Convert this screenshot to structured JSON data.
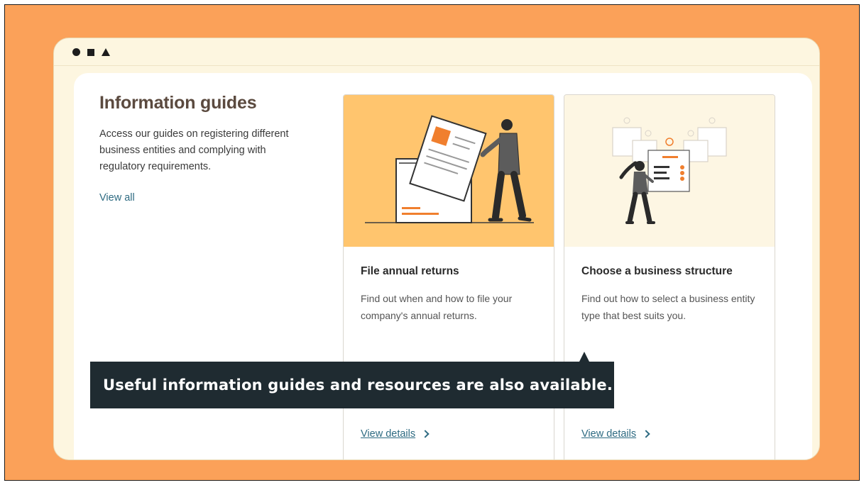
{
  "window": {
    "controls": [
      "circle",
      "square",
      "triangle"
    ]
  },
  "intro": {
    "title": "Information guides",
    "description": "Access our guides on registering different business entities and complying with regulatory requirements.",
    "view_all": "View all"
  },
  "cards": [
    {
      "title": "File annual returns",
      "description": "Find out when and how to file your company's annual returns.",
      "link": "View details",
      "illustration": "person-filing-documents-illustration"
    },
    {
      "title": "Choose a business structure",
      "description": "Find out how to select a business entity type that best suits you.",
      "link": "View details",
      "illustration": "person-choosing-structure-illustration"
    }
  ],
  "tooltip": {
    "text": "Useful information guides and resources are also available."
  },
  "colors": {
    "backdrop": "#fba159",
    "card_1_image_bg": "#ffc56e",
    "card_2_image_bg": "#fdf6e3",
    "link": "#2e6b82",
    "tooltip_bg": "#1f2b31",
    "accent": "#f07f2e"
  }
}
